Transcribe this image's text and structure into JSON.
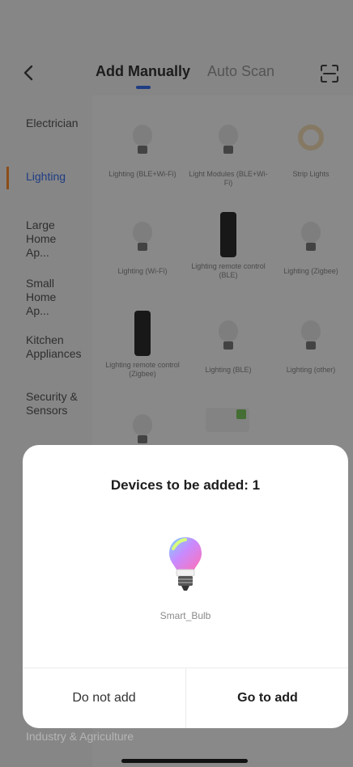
{
  "header": {
    "tabs": [
      "Add Manually",
      "Auto Scan"
    ],
    "active_tab": 0
  },
  "sidebar": {
    "categories": [
      "Electrician",
      "Lighting",
      "Large Home Ap...",
      "Small Home Ap...",
      "Kitchen Appliances",
      "Security & Sensors",
      "Industry & Agriculture"
    ],
    "active_index": 1
  },
  "grid": {
    "items": [
      {
        "label": "Lighting (BLE+Wi-Fi)",
        "icon": "bulb-icon"
      },
      {
        "label": "Light Modules (BLE+Wi-Fi)",
        "icon": "bulb-icon"
      },
      {
        "label": "Strip Lights",
        "icon": "light-ring-icon"
      },
      {
        "label": "Lighting (Wi-Fi)",
        "icon": "bulb-icon"
      },
      {
        "label": "Lighting remote control (BLE)",
        "icon": "remote-icon"
      },
      {
        "label": "Lighting (Zigbee)",
        "icon": "bulb-icon"
      },
      {
        "label": "Lighting remote control (Zigbee)",
        "icon": "remote-icon"
      },
      {
        "label": "Lighting (BLE)",
        "icon": "bulb-icon"
      },
      {
        "label": "Lighting (other)",
        "icon": "bulb-icon"
      }
    ]
  },
  "dialog": {
    "title": "Devices to be added: 1",
    "device_name": "Smart_Bulb",
    "cancel_label": "Do not add",
    "confirm_label": "Go to add"
  },
  "colors": {
    "accent": "#3a6ff0",
    "active_marker": "#ff8a2a",
    "overlay": "#000000"
  }
}
